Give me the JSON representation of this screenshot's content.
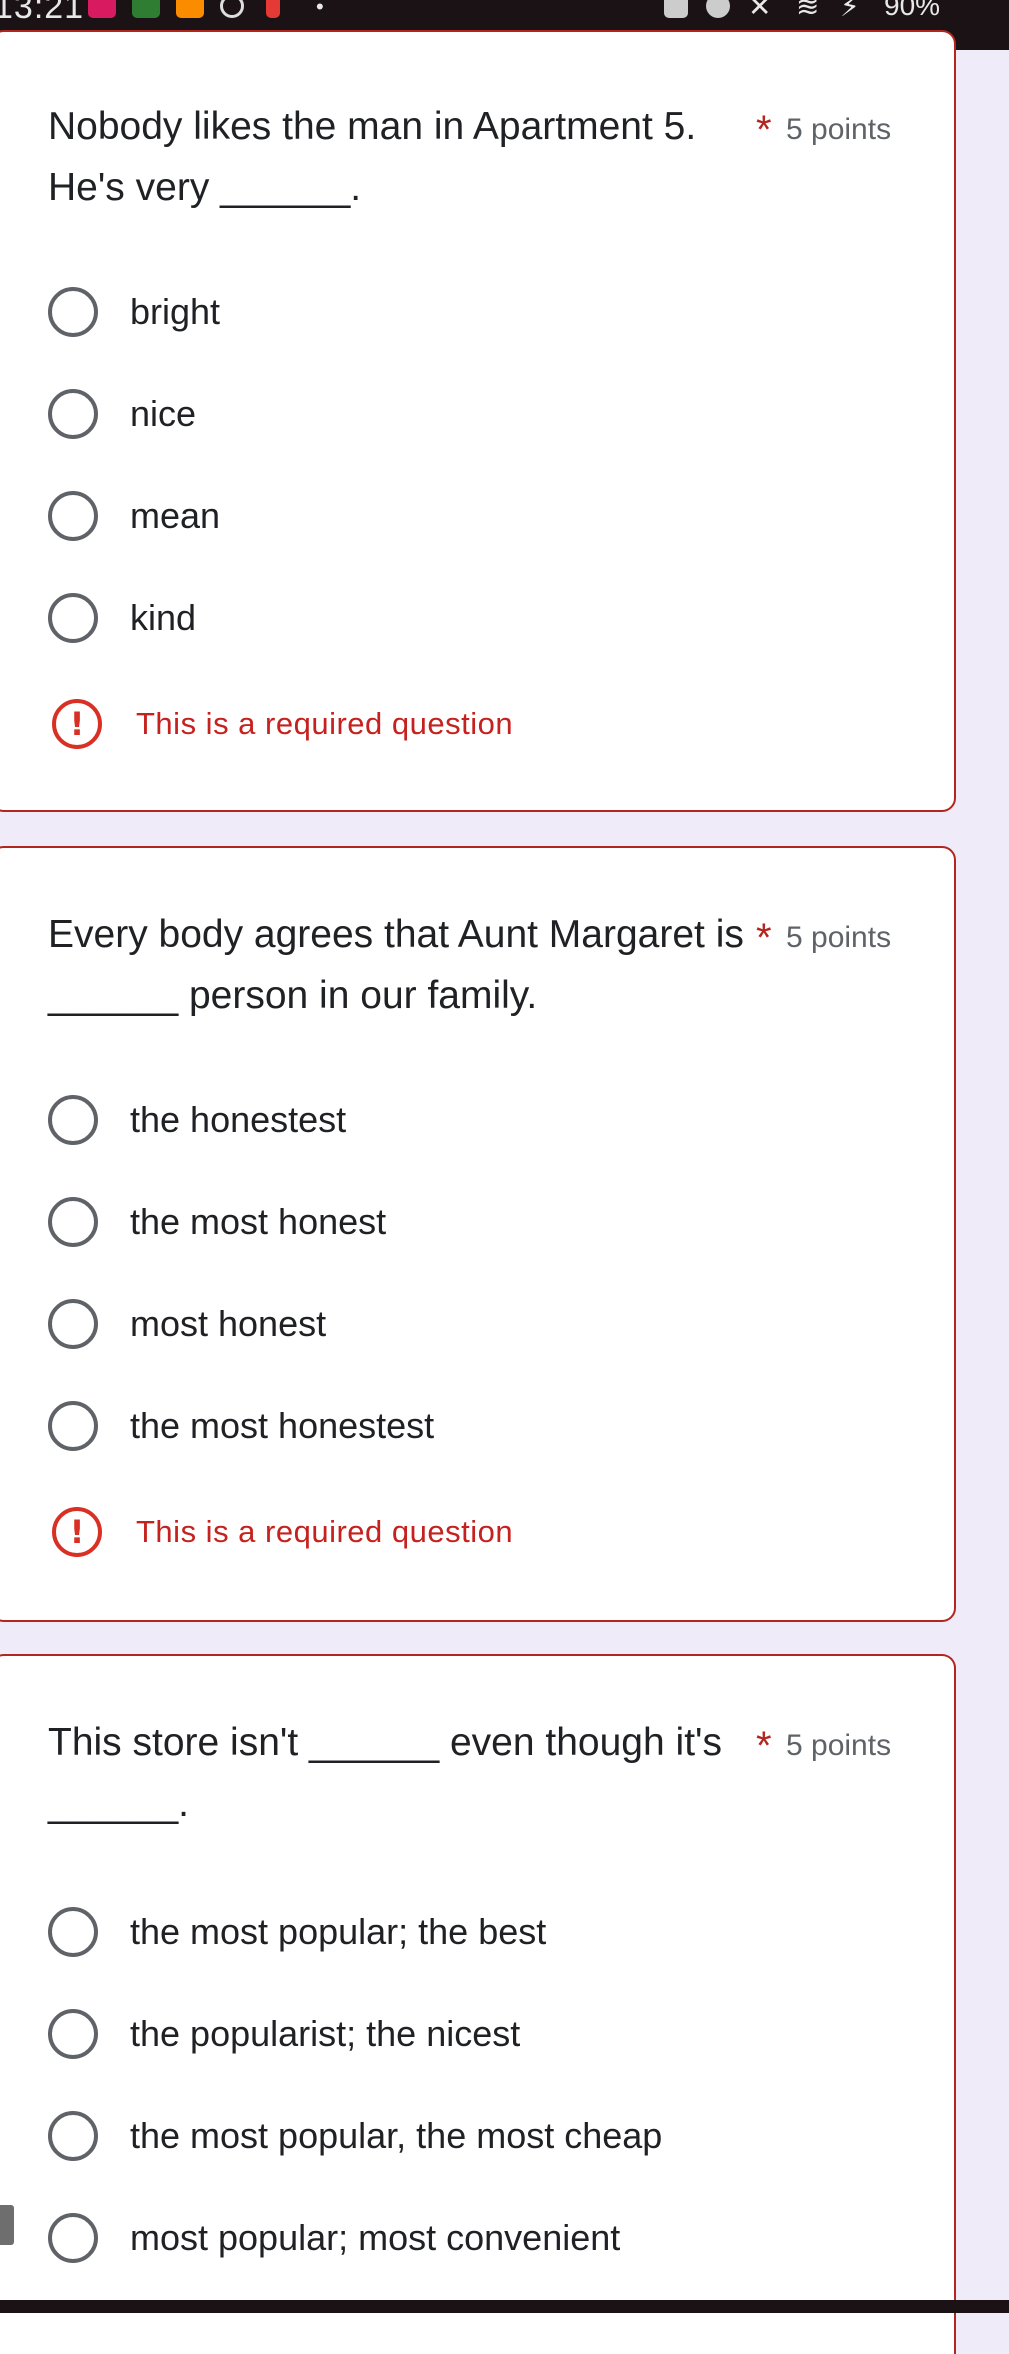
{
  "status_bar": {
    "time": "13:21",
    "battery": "90%",
    "app_colors": [
      "#d81b60",
      "#2e7d32",
      "#fb8c00"
    ]
  },
  "questions": [
    {
      "text": "Nobody likes the man in Apartment 5. He's very ______.",
      "required_mark": "*",
      "points": "5 points",
      "options": [
        "bright",
        "nice",
        "mean",
        "kind"
      ],
      "error": "This is a required question"
    },
    {
      "text": "Every body agrees that Aunt Margaret is ______ person in our family.",
      "required_mark": "*",
      "points": "5 points",
      "options": [
        "the honestest",
        "the most honest",
        "most honest",
        "the most honestest"
      ],
      "error": "This is a required question"
    },
    {
      "text": "This store isn't ______ even though it's ______.",
      "required_mark": "*",
      "points": "5 points",
      "options": [
        "the most popular; the best",
        "the popularist; the nicest",
        "the most popular, the most cheap",
        "most popular; most convenient"
      ]
    }
  ],
  "colors": {
    "page_background": "#f0ebf8",
    "error_red": "#d93025",
    "card_border": "#b3261e"
  }
}
